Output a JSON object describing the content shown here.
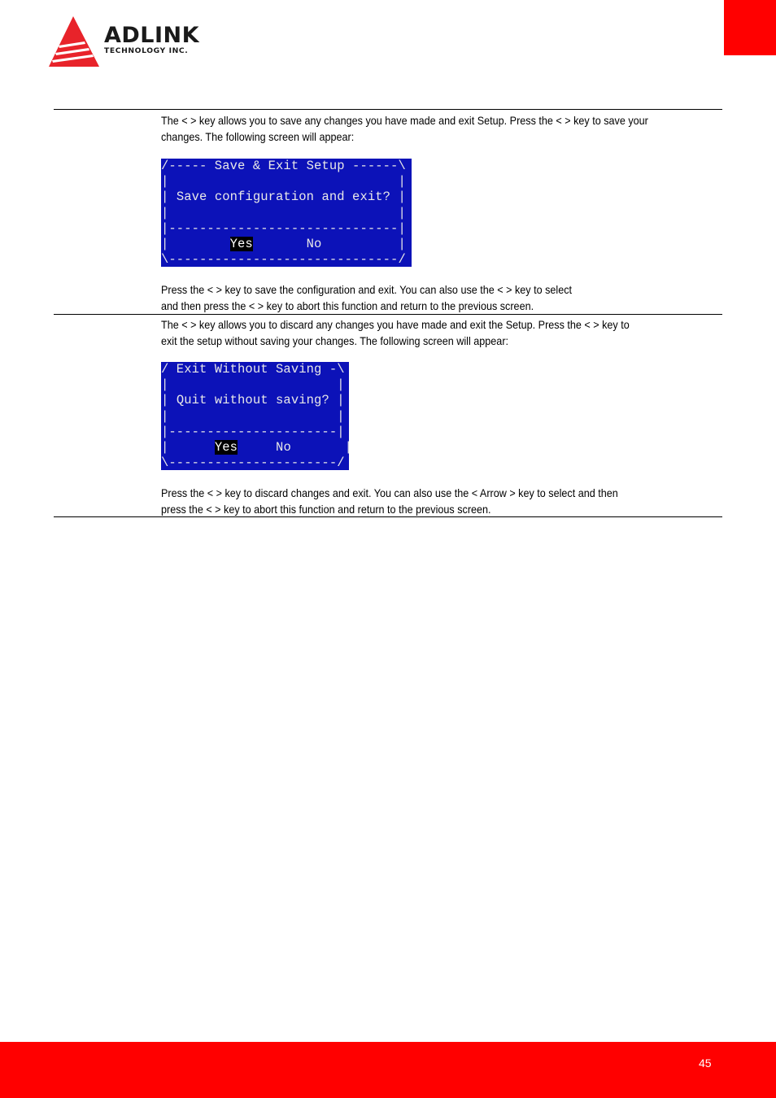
{
  "header": {
    "brand": "ADLINK",
    "brand_sub": "TECHNOLOGY INC.",
    "brand_color": "#e8232a"
  },
  "section_save": {
    "intro_line1": "The <       > key allows you to save any changes you have made and exit Setup. Press the <       > key to save your",
    "intro_line2": "changes. The following screen will appear:",
    "dialog": {
      "title_line": "/----- Save & Exit Setup ------\\",
      "blank_line": "|                              |",
      "prompt_pre": "| ",
      "prompt": "Save configuration and exit?",
      "prompt_post": " |",
      "separator": "|------------------------------|",
      "options_pre": "|        ",
      "yes": "Yes",
      "options_mid": "       ",
      "no": "No",
      "options_post": "          |",
      "bottom_line": "\\------------------------------/"
    },
    "note_line1": "Press the <              > key to save the configuration and exit. You can also use the <              > key to select",
    "note_line2": "and then press the <              > key to abort this function and return to the previous screen."
  },
  "section_discard": {
    "intro_line1": "The <         > key allows you to discard any changes you have made and exit the Setup. Press the <         > key to",
    "intro_line2": "exit the setup without saving your changes. The following screen will appear:",
    "dialog": {
      "title_line": "/ Exit Without Saving -\\",
      "blank_line": "|                      |",
      "prompt_pre": "| ",
      "prompt": "Quit without saving?",
      "prompt_post": " |",
      "separator": "|----------------------|",
      "options_pre": "|      ",
      "yes": "Yes",
      "options_mid": "     ",
      "no": "No",
      "options_post": "       |",
      "bottom_line": "\\----------------------/"
    },
    "note_line1": "Press the <              > key to discard changes and exit. You can also use the < Arrow > key to select              and then",
    "note_line2": "press the <              > key to abort this function and return to the previous screen."
  },
  "footer": {
    "page_number": "45"
  }
}
